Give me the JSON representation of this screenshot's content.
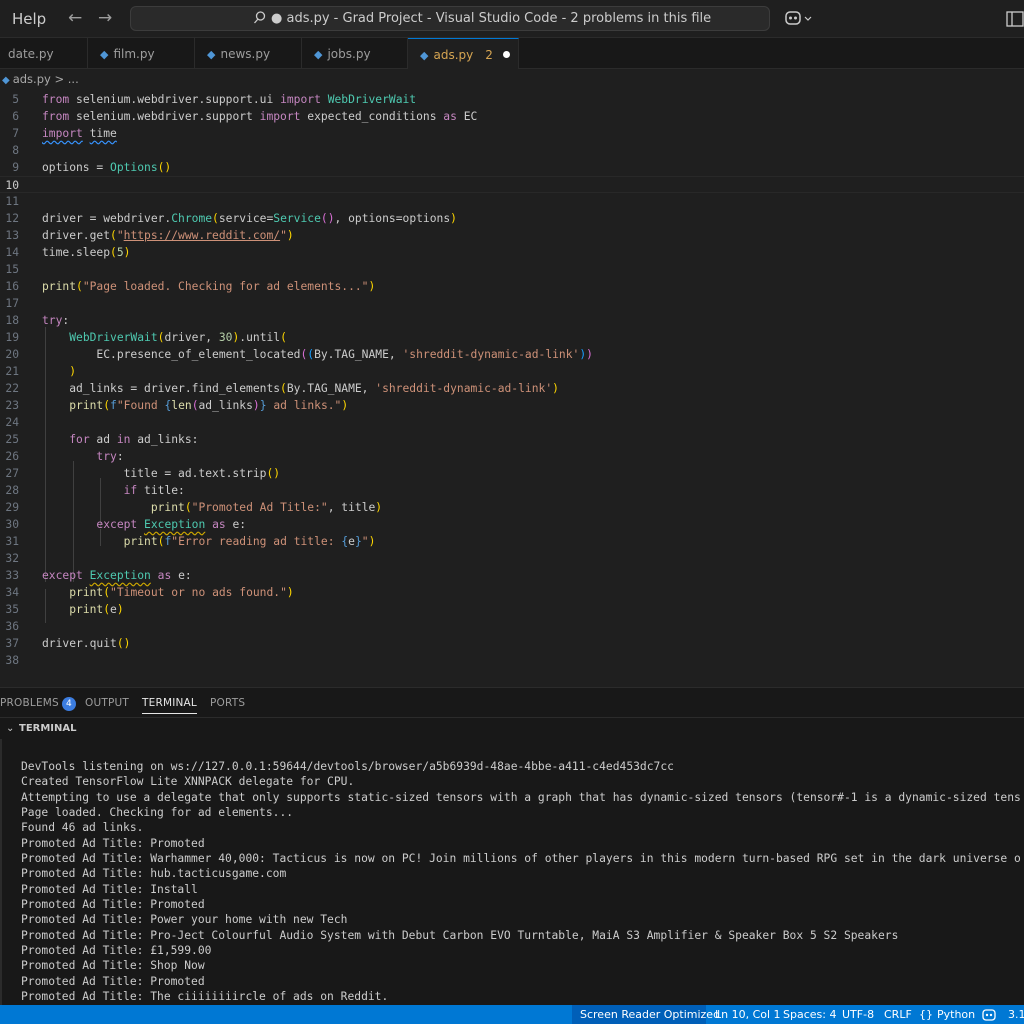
{
  "titlebar": {
    "menu_help": "Help",
    "back_icon": "←",
    "forward_icon": "→",
    "search_text": "● ads.py - Grad Project - Visual Studio Code - 2 problems in this file"
  },
  "tabs": [
    {
      "label": "date.py"
    },
    {
      "label": "film.py"
    },
    {
      "label": "news.py"
    },
    {
      "label": "jobs.py"
    },
    {
      "label": "ads.py",
      "badge": "2"
    }
  ],
  "breadcrumb": {
    "file": "ads.py",
    "sep": "> ..."
  },
  "editor": {
    "line_numbers": [
      "5",
      "6",
      "7",
      "8",
      "9",
      "10",
      "11",
      "12",
      "13",
      "14",
      "15",
      "16",
      "17",
      "18",
      "19",
      "20",
      "21",
      "22",
      "23",
      "24",
      "25",
      "26",
      "27",
      "28",
      "29",
      "30",
      "31",
      "32",
      "33",
      "34",
      "35",
      "36",
      "37",
      "38"
    ],
    "current_line": "10"
  },
  "panel": {
    "tabs": [
      "PROBLEMS",
      "OUTPUT",
      "TERMINAL",
      "PORTS"
    ],
    "problems_count": "4",
    "section_title": "TERMINAL",
    "terminal_lines": [
      "DevTools listening on ws://127.0.0.1:59644/devtools/browser/a5b6939d-48ae-4bbe-a411-c4ed453dc7cc",
      "Created TensorFlow Lite XNNPACK delegate for CPU.",
      "Attempting to use a delegate that only supports static-sized tensors with a graph that has dynamic-sized tensors (tensor#-1 is a dynamic-sized tens",
      "Page loaded. Checking for ad elements...",
      "Found 46 ad links.",
      "Promoted Ad Title: Promoted",
      "Promoted Ad Title: Warhammer 40,000: Tacticus is now on PC! Join millions of other players in this modern turn-based RPG set in the dark universe o",
      "Promoted Ad Title: hub.tacticusgame.com",
      "Promoted Ad Title: Install",
      "Promoted Ad Title: Promoted",
      "Promoted Ad Title: Power your home with new Tech",
      "Promoted Ad Title: Pro-Ject Colourful Audio System with Debut Carbon EVO Turntable, MaiA S3 Amplifier & Speaker Box 5 S2 Speakers",
      "Promoted Ad Title: £1,599.00",
      "Promoted Ad Title: Shop Now",
      "Promoted Ad Title: Promoted",
      "Promoted Ad Title: The ciiiiiiiircle of ads on Reddit."
    ]
  },
  "statusbar": {
    "screen_reader": "Screen Reader Optimized",
    "position": "Ln 10, Col 1",
    "spaces": "Spaces: 4",
    "encoding": "UTF-8",
    "eol": "CRLF",
    "language_icon": "{}",
    "language": "Python",
    "version": "3.1"
  },
  "colors": {
    "accent": "#0078d4",
    "tab_active_text": "#d6a552",
    "keyword": "#c586c0",
    "string": "#ce9178",
    "function": "#dcdcaa"
  }
}
